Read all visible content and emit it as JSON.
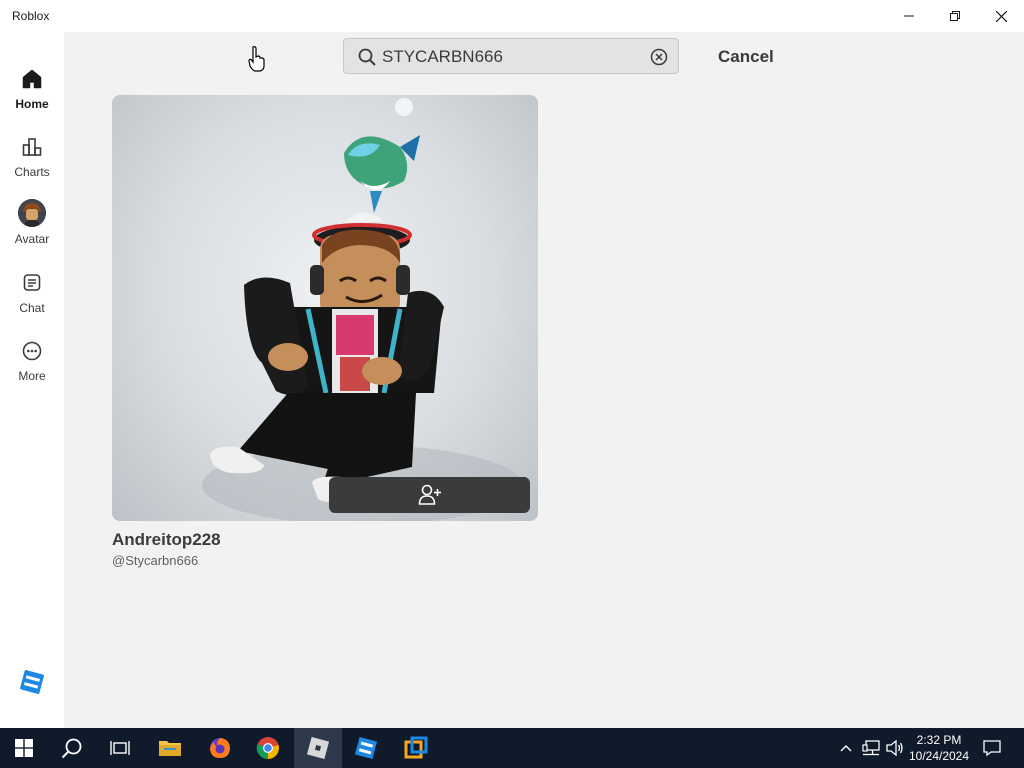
{
  "window": {
    "title": "Roblox"
  },
  "sidebar": {
    "items": [
      {
        "label": "Home",
        "icon": "home-icon",
        "active": true
      },
      {
        "label": "Charts",
        "icon": "charts-icon",
        "active": false
      },
      {
        "label": "Avatar",
        "icon": "avatar-icon",
        "active": false
      },
      {
        "label": "Chat",
        "icon": "chat-icon",
        "active": false
      },
      {
        "label": "More",
        "icon": "more-icon",
        "active": false
      }
    ]
  },
  "search": {
    "value": "STYCARBN666",
    "cancel_label": "Cancel"
  },
  "result": {
    "display_name": "Andreitop228",
    "username": "@Stycarbn666"
  },
  "taskbar": {
    "time": "2:32 PM",
    "date": "10/24/2024"
  },
  "colors": {
    "accent_dark": "#393b3d",
    "taskbar": "#0f1a2a",
    "roblox_blue": "#1e88e5"
  }
}
